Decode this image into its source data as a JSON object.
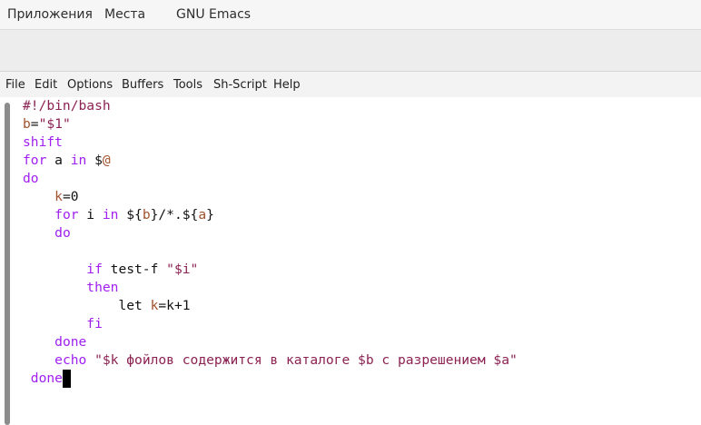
{
  "top_panel": {
    "applications": "Приложения",
    "places": "Места",
    "app_title": "GNU Emacs"
  },
  "menubar": {
    "items": [
      "File",
      "Edit",
      "Options",
      "Buffers",
      "Tools",
      "Sh-Script",
      "Help"
    ]
  },
  "editor": {
    "lines": [
      [
        {
          "t": "#!/bin/bash",
          "c": "str"
        }
      ],
      [
        {
          "t": "b",
          "c": "var"
        },
        {
          "t": "=",
          "c": ""
        },
        {
          "t": "\"$1\"",
          "c": "str"
        }
      ],
      [
        {
          "t": "shift",
          "c": "kw"
        }
      ],
      [
        {
          "t": "for",
          "c": "kw"
        },
        {
          "t": " a ",
          "c": ""
        },
        {
          "t": "in",
          "c": "kw"
        },
        {
          "t": " $",
          "c": ""
        },
        {
          "t": "@",
          "c": "var"
        }
      ],
      [
        {
          "t": "do",
          "c": "kw"
        }
      ],
      [
        {
          "t": "    ",
          "c": ""
        },
        {
          "t": "k",
          "c": "var"
        },
        {
          "t": "=0",
          "c": ""
        }
      ],
      [
        {
          "t": "    ",
          "c": ""
        },
        {
          "t": "for",
          "c": "kw"
        },
        {
          "t": " i ",
          "c": ""
        },
        {
          "t": "in",
          "c": "kw"
        },
        {
          "t": " ${",
          "c": ""
        },
        {
          "t": "b",
          "c": "var"
        },
        {
          "t": "}/*.${",
          "c": ""
        },
        {
          "t": "a",
          "c": "var"
        },
        {
          "t": "}",
          "c": ""
        }
      ],
      [
        {
          "t": "    ",
          "c": ""
        },
        {
          "t": "do",
          "c": "kw"
        }
      ],
      [
        {
          "t": "",
          "c": ""
        }
      ],
      [
        {
          "t": "        ",
          "c": ""
        },
        {
          "t": "if",
          "c": "kw"
        },
        {
          "t": " test-f ",
          "c": ""
        },
        {
          "t": "\"$i\"",
          "c": "str"
        }
      ],
      [
        {
          "t": "        ",
          "c": ""
        },
        {
          "t": "then",
          "c": "kw"
        }
      ],
      [
        {
          "t": "            let ",
          "c": ""
        },
        {
          "t": "k",
          "c": "var"
        },
        {
          "t": "=k+1",
          "c": ""
        }
      ],
      [
        {
          "t": "        ",
          "c": ""
        },
        {
          "t": "fi",
          "c": "kw"
        }
      ],
      [
        {
          "t": "    ",
          "c": ""
        },
        {
          "t": "done",
          "c": "kw"
        }
      ],
      [
        {
          "t": "    ",
          "c": ""
        },
        {
          "t": "echo",
          "c": "kw"
        },
        {
          "t": " ",
          "c": ""
        },
        {
          "t": "\"$k фойлов содержится в каталоге $b с разрешением $a\"",
          "c": "str"
        }
      ],
      [
        {
          "t": " ",
          "c": ""
        },
        {
          "t": "done",
          "c": "kw"
        }
      ]
    ]
  }
}
